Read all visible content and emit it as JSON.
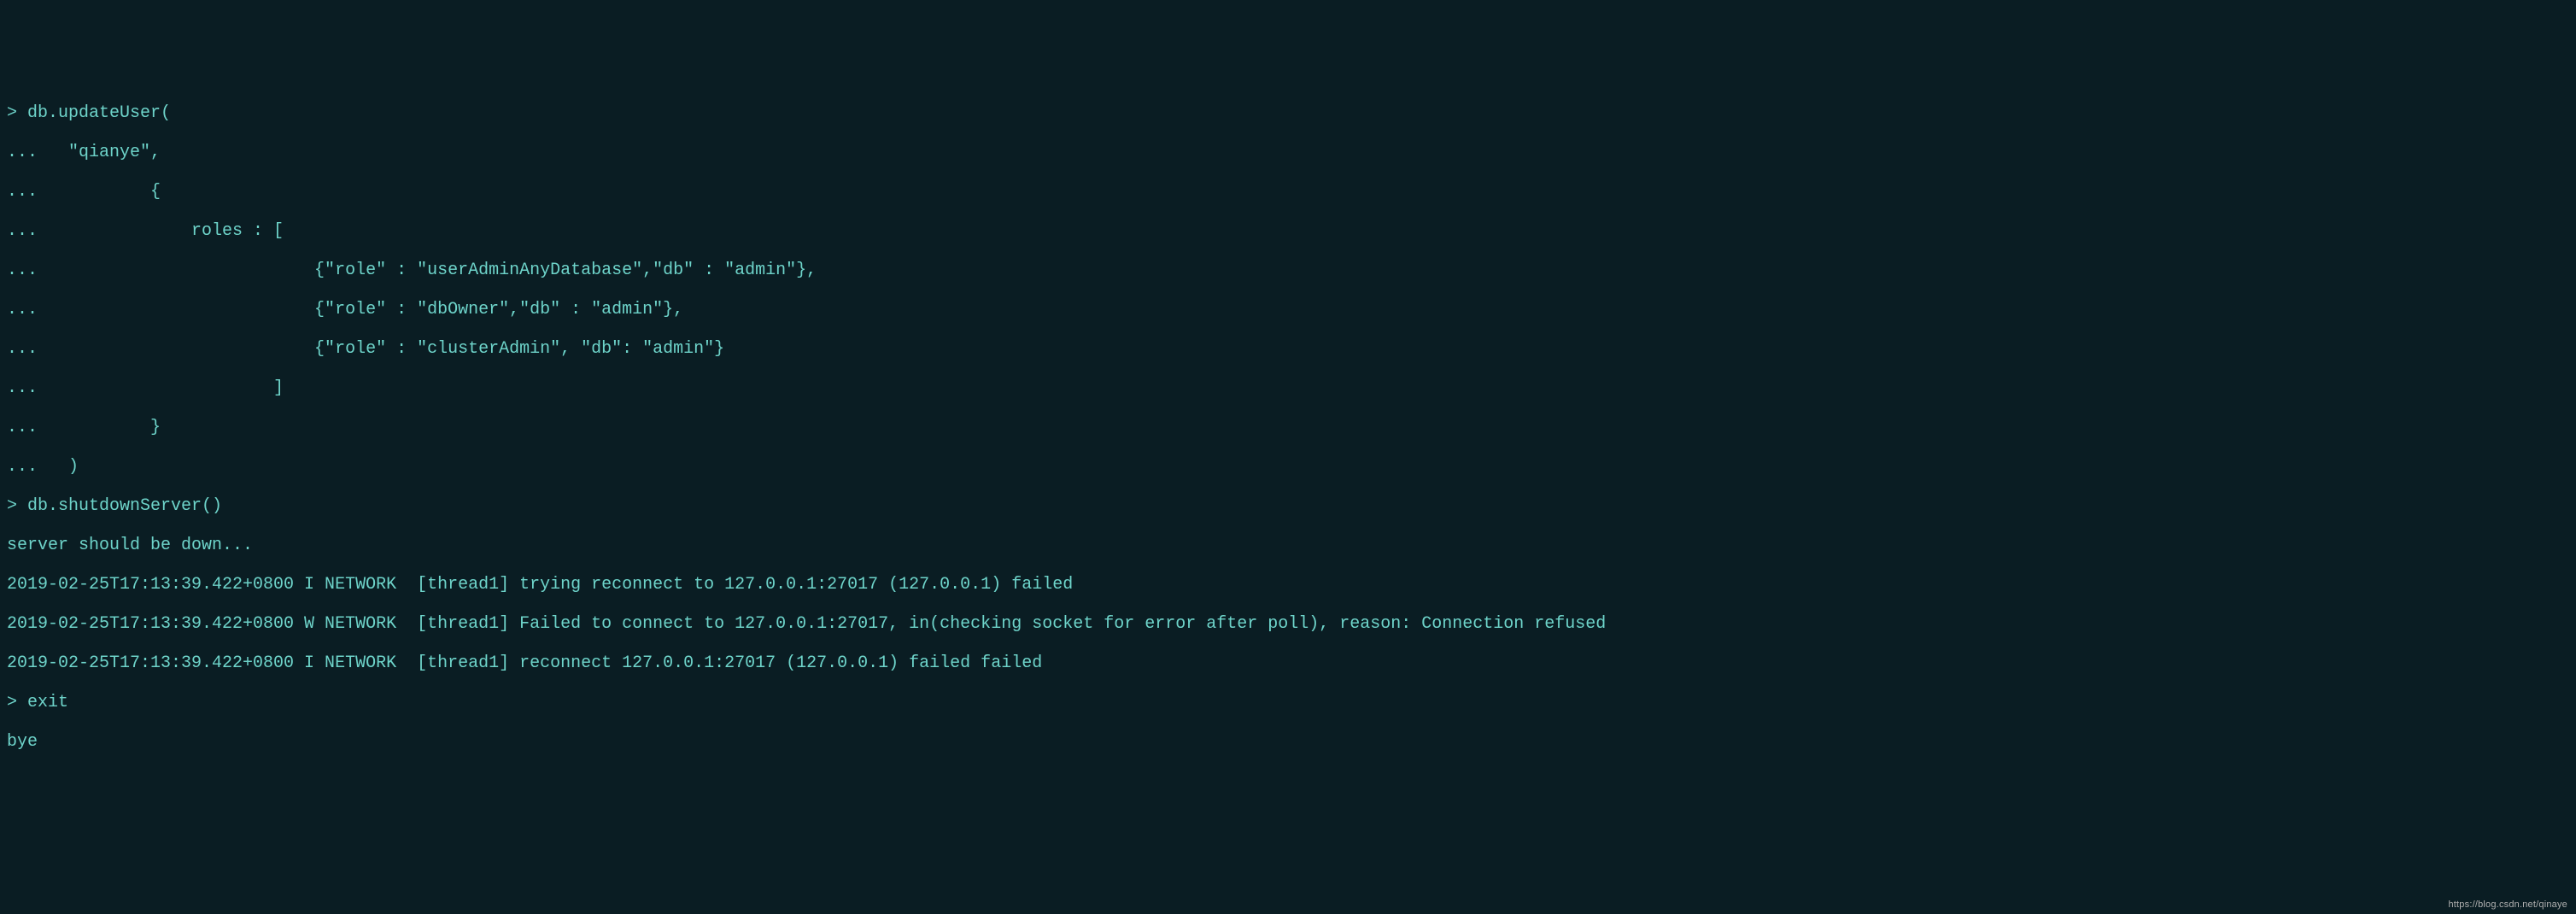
{
  "terminal": {
    "lines": [
      "> db.updateUser(",
      "...   \"qianye\",",
      "...           {",
      "...               roles : [",
      "...                           {\"role\" : \"userAdminAnyDatabase\",\"db\" : \"admin\"},",
      "...                           {\"role\" : \"dbOwner\",\"db\" : \"admin\"},",
      "...                           {\"role\" : \"clusterAdmin\", \"db\": \"admin\"}",
      "...                       ]",
      "...           }",
      "...   )",
      "> db.shutdownServer()",
      "server should be down...",
      "2019-02-25T17:13:39.422+0800 I NETWORK  [thread1] trying reconnect to 127.0.0.1:27017 (127.0.0.1) failed",
      "2019-02-25T17:13:39.422+0800 W NETWORK  [thread1] Failed to connect to 127.0.0.1:27017, in(checking socket for error after poll), reason: Connection refused",
      "2019-02-25T17:13:39.422+0800 I NETWORK  [thread1] reconnect 127.0.0.1:27017 (127.0.0.1) failed failed",
      "> exit",
      "bye"
    ]
  },
  "watermark": {
    "text": "https://blog.csdn.net/qinaye"
  }
}
